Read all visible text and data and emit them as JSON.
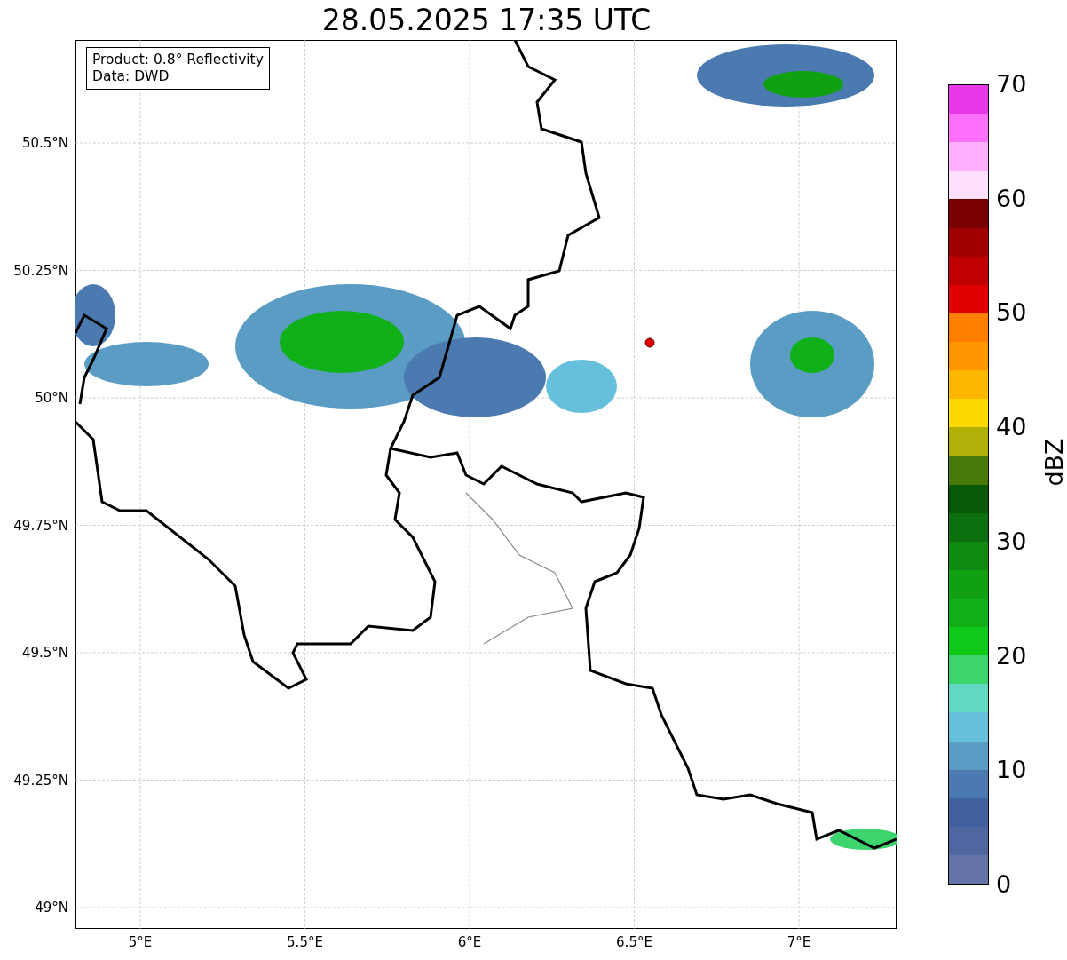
{
  "title": "28.05.2025 17:35 UTC",
  "info_box": [
    "Product: 0.8° Reflectivity",
    "Data: DWD"
  ],
  "lat_ticks": [
    "50.5°N",
    "50.25°N",
    "50°N",
    "49.75°N",
    "49.5°N",
    "49.25°N",
    "49°N"
  ],
  "lon_ticks": [
    "5°E",
    "5.5°E",
    "6°E",
    "6.5°E",
    "7°E"
  ],
  "colorbar": {
    "label": "dBZ",
    "ticks": [
      "70",
      "60",
      "50",
      "40",
      "30",
      "20",
      "10",
      "0"
    ],
    "bins": [
      {
        "color": "#6474a8"
      },
      {
        "color": "#5066a0"
      },
      {
        "color": "#4060a0"
      },
      {
        "color": "#4a7ab0"
      },
      {
        "color": "#5a9cc4"
      },
      {
        "color": "#66c0dc"
      },
      {
        "color": "#60d8c4"
      },
      {
        "color": "#3cd46c"
      },
      {
        "color": "#10c818"
      },
      {
        "color": "#10b018"
      },
      {
        "color": "#10a010"
      },
      {
        "color": "#108a10"
      },
      {
        "color": "#0c7010"
      },
      {
        "color": "#085808"
      },
      {
        "color": "#487808"
      },
      {
        "color": "#b0b008"
      },
      {
        "color": "#ffd800"
      },
      {
        "color": "#ffb800"
      },
      {
        "color": "#ff9800"
      },
      {
        "color": "#ff8000"
      },
      {
        "color": "#e00000"
      },
      {
        "color": "#c00000"
      },
      {
        "color": "#a00000"
      },
      {
        "color": "#780000"
      },
      {
        "color": "#ffe0ff"
      },
      {
        "color": "#ffb0ff"
      },
      {
        "color": "#ff70ff"
      },
      {
        "color": "#e838e8"
      }
    ]
  }
}
